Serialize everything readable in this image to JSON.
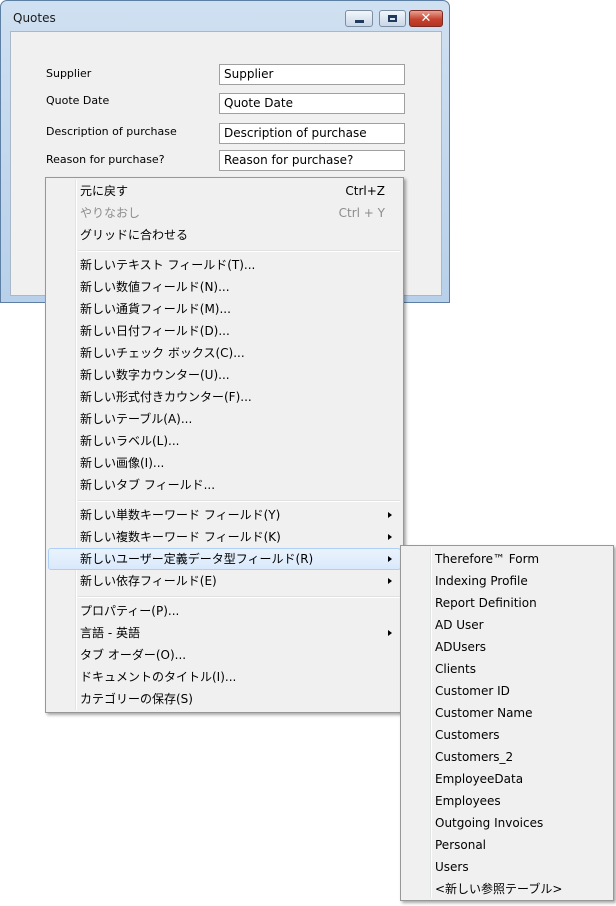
{
  "window": {
    "title": "Quotes",
    "buttons": {
      "minimize": "minimize-icon",
      "maximize": "maximize-icon",
      "close": "close-icon"
    }
  },
  "form": {
    "fields": [
      {
        "label": "Supplier",
        "value": "Supplier"
      },
      {
        "label": "Quote Date",
        "value": "Quote Date"
      },
      {
        "label": "Description of purchase",
        "value": "Description of purchase"
      },
      {
        "label": "Reason for purchase?",
        "value": "Reason for purchase?"
      }
    ]
  },
  "context_menu": {
    "items": [
      {
        "label": "元に戻す",
        "shortcut": "Ctrl+Z"
      },
      {
        "label": "やりなおし",
        "shortcut": "Ctrl + Y",
        "disabled": true
      },
      {
        "label": "グリッドに合わせる"
      },
      {
        "label": "新しいテキスト フィールド(T)..."
      },
      {
        "label": "新しい数値フィールド(N)..."
      },
      {
        "label": "新しい通貨フィールド(M)..."
      },
      {
        "label": "新しい日付フィールド(D)..."
      },
      {
        "label": "新しいチェック ボックス(C)..."
      },
      {
        "label": "新しい数字カウンター(U)..."
      },
      {
        "label": "新しい形式付きカウンター(F)..."
      },
      {
        "label": "新しいテーブル(A)..."
      },
      {
        "label": "新しいラベル(L)..."
      },
      {
        "label": "新しい画像(I)..."
      },
      {
        "label": "新しいタブ フィールド..."
      },
      {
        "label": "新しい単数キーワード フィールド(Y)",
        "submenu": true
      },
      {
        "label": "新しい複数キーワード フィールド(K)",
        "submenu": true
      },
      {
        "label": "新しいユーザー定義データ型フィールド(R)",
        "submenu": true,
        "highlighted": true
      },
      {
        "label": "新しい依存フィールド(E)",
        "submenu": true
      },
      {
        "label": "プロパティー(P)..."
      },
      {
        "label": "言語 - 英語",
        "submenu": true
      },
      {
        "label": "タブ オーダー(O)..."
      },
      {
        "label": "ドキュメントのタイトル(I)..."
      },
      {
        "label": "カテゴリーの保存(S)"
      }
    ]
  },
  "submenu": {
    "items": [
      "Therefore™ Form",
      "Indexing Profile",
      "Report Definition",
      "AD User",
      "ADUsers",
      "Clients",
      "Customer ID",
      "Customer Name",
      "Customers",
      "Customers_2",
      "EmployeeData",
      "Employees",
      "Outgoing Invoices",
      "Personal",
      "Users",
      "<新しい参照テーブル>"
    ]
  },
  "colors": {
    "menu_bg": "#f0f0f0",
    "highlight_border": "#aecff7",
    "close_button": "#c5432f"
  }
}
